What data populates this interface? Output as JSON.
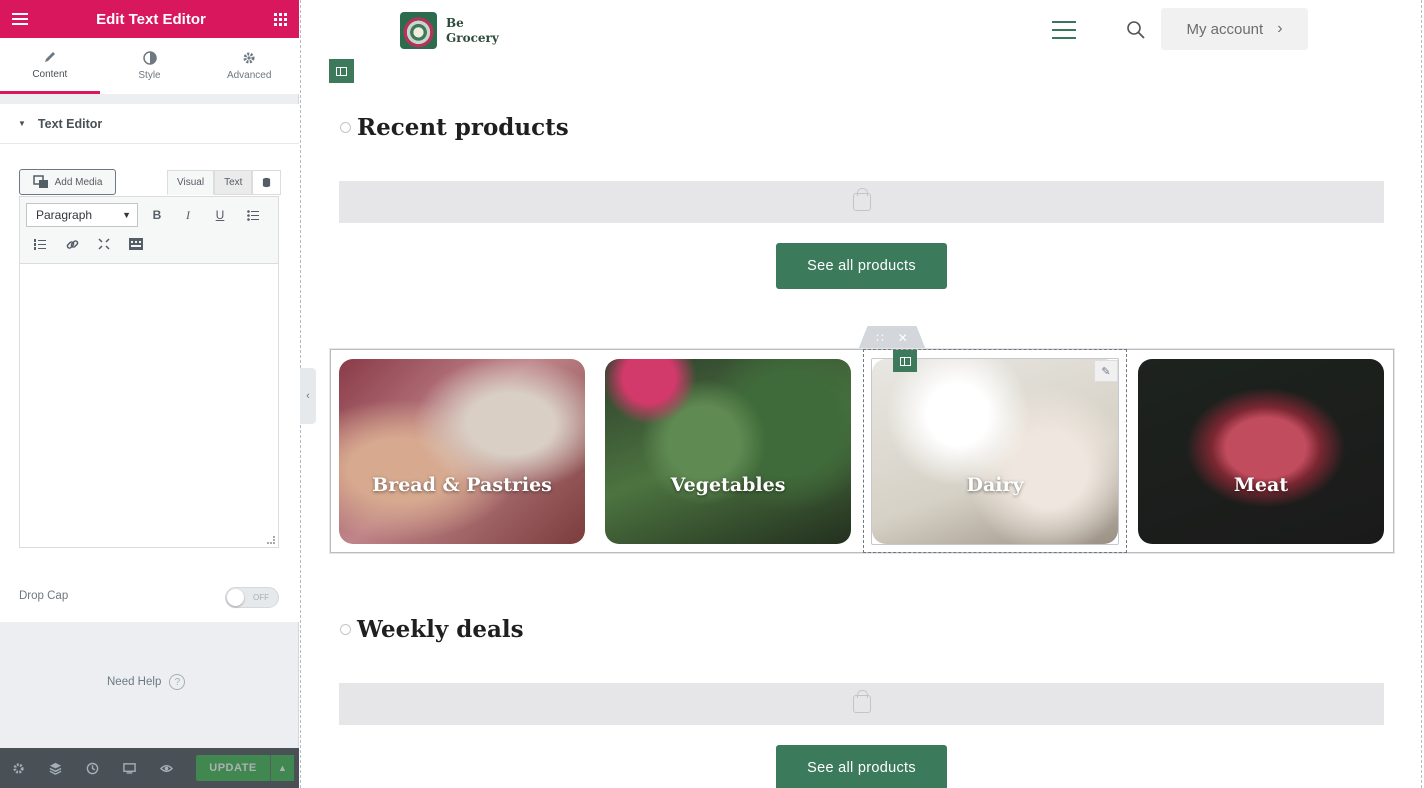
{
  "panel": {
    "title": "Edit Text Editor",
    "tabs": [
      {
        "label": "Content",
        "icon": "pencil-icon",
        "active": true
      },
      {
        "label": "Style",
        "icon": "contrast-icon",
        "active": false
      },
      {
        "label": "Advanced",
        "icon": "gear-icon",
        "active": false
      }
    ],
    "section_title": "Text Editor",
    "add_media_label": "Add Media",
    "visual_tab": "Visual",
    "text_tab": "Text",
    "format_select": "Paragraph",
    "drop_cap_label": "Drop Cap",
    "drop_cap_state": "OFF",
    "need_help": "Need Help",
    "update_label": "UPDATE"
  },
  "site": {
    "logo_line1": "Be",
    "logo_line2": "Grocery",
    "my_account": "My account",
    "recent_products": "Recent products",
    "see_all_1": "See all products",
    "weekly_deals": "Weekly deals",
    "see_all_2": "See all products",
    "categories": [
      "Bread & Pastries",
      "Vegetables",
      "Dairy",
      "Meat"
    ]
  },
  "colors": {
    "accent": "#d8175c",
    "brand_green": "#3b7a5b",
    "panel_footer": "#495157"
  }
}
